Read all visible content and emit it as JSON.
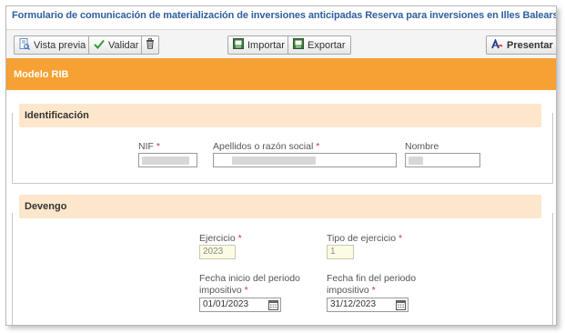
{
  "page": {
    "title": "Formulario de comunicación de materialización de inversiones anticipadas Reserva para inversiones en Illes Balears (RIIB)"
  },
  "toolbar": {
    "preview_label": "Vista previa",
    "validate_label": "Validar",
    "import_label": "Importar",
    "export_label": "Exportar",
    "submit_label": "Presentar"
  },
  "model": {
    "title": "Modelo RIB"
  },
  "identificacion": {
    "title": "Identificación",
    "nif_label": "NIF",
    "apellidos_label": "Apellidos o razón social",
    "nombre_label": "Nombre",
    "required_mark": "*"
  },
  "devengo": {
    "title": "Devengo",
    "ejercicio_label": "Ejercicio",
    "ejercicio_value": "2023",
    "tipo_label": "Tipo de ejercicio",
    "tipo_value": "1",
    "fecha_inicio_label_1": "Fecha inicio del periodo",
    "fecha_inicio_label_2": "impositivo",
    "fecha_inicio_value": "01/01/2023",
    "fecha_fin_label_1": "Fecha fin del periodo",
    "fecha_fin_label_2": "impositivo",
    "fecha_fin_value": "31/12/2023",
    "required_mark": "*"
  },
  "colors": {
    "accent": "#f7a033",
    "section_header": "#fde7cc",
    "title_text": "#2f5f9e"
  }
}
